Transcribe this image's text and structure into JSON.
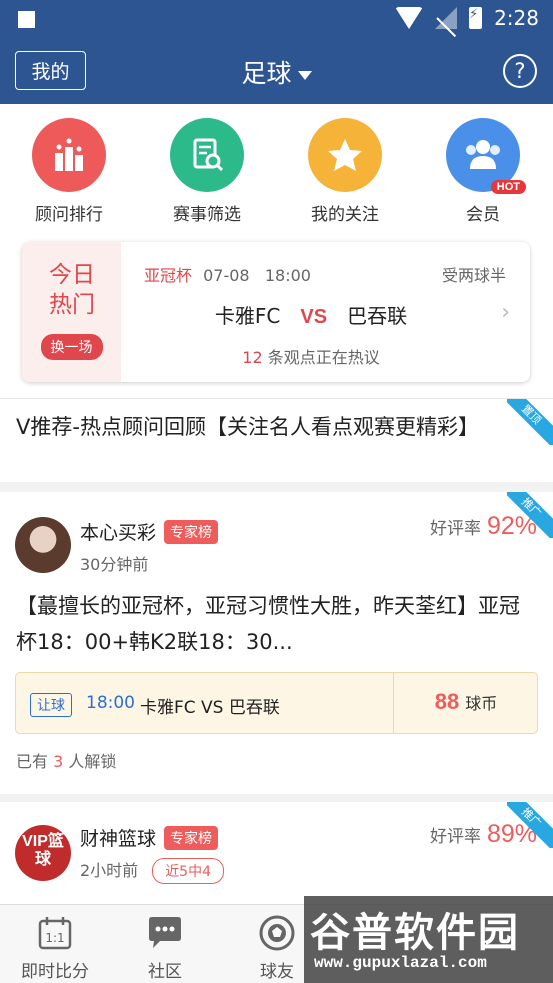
{
  "status_bar": {
    "time": "2:28"
  },
  "header": {
    "my_label": "我的",
    "title": "足球"
  },
  "quick_actions": [
    {
      "label": "顾问排行",
      "icon": "ranking-icon",
      "color": "#ee5a5a"
    },
    {
      "label": "赛事筛选",
      "icon": "match-filter-icon",
      "color": "#2dba8a"
    },
    {
      "label": "我的关注",
      "icon": "star-icon",
      "color": "#f5b33a"
    },
    {
      "label": "会员",
      "icon": "members-icon",
      "color": "#4a90e8",
      "badge": "HOT"
    }
  ],
  "today_hot": {
    "label": "今日热门",
    "swap_label": "换一场",
    "league": "亚冠杯",
    "date": "07-08",
    "time": "18:00",
    "handicap": "受两球半",
    "home": "卡雅FC",
    "vs": "VS",
    "away": "巴吞联",
    "views_count": "12",
    "views_text": "条观点正在热议"
  },
  "pinned": {
    "text": "V推荐-热点顾问回顾【关注名人看点观赛更精彩】",
    "ribbon": "置顶"
  },
  "posts": [
    {
      "name": "本心买彩",
      "tag": "专家榜",
      "time": "30分钟前",
      "rate_label": "好评率",
      "rate": "92%",
      "ribbon": "推广",
      "content": "【蕞擅长的亚冠杯，亚冠习惯性大胜，昨天荃红】亚冠杯18：00+韩K2联18：30...",
      "match": {
        "type": "让球",
        "time": "18:00",
        "name": "卡雅FC VS 巴吞联",
        "price": "88",
        "currency": "球币"
      },
      "unlock_prefix": "已有",
      "unlock_count": "3",
      "unlock_suffix": "人解锁"
    },
    {
      "name": "财神篮球",
      "tag": "专家榜",
      "time": "2小时前",
      "record": "近5中4",
      "rate_label": "好评率",
      "rate": "89%",
      "ribbon": "推广",
      "avatar_text": "VIP篮球"
    }
  ],
  "tabs": [
    {
      "label": "即时比分",
      "icon": "calendar-icon"
    },
    {
      "label": "社区",
      "icon": "chat-icon"
    },
    {
      "label": "球友",
      "icon": "football-icon"
    }
  ],
  "watermark": {
    "title": "谷普软件园",
    "url": "www.gupuxlazal.com"
  }
}
